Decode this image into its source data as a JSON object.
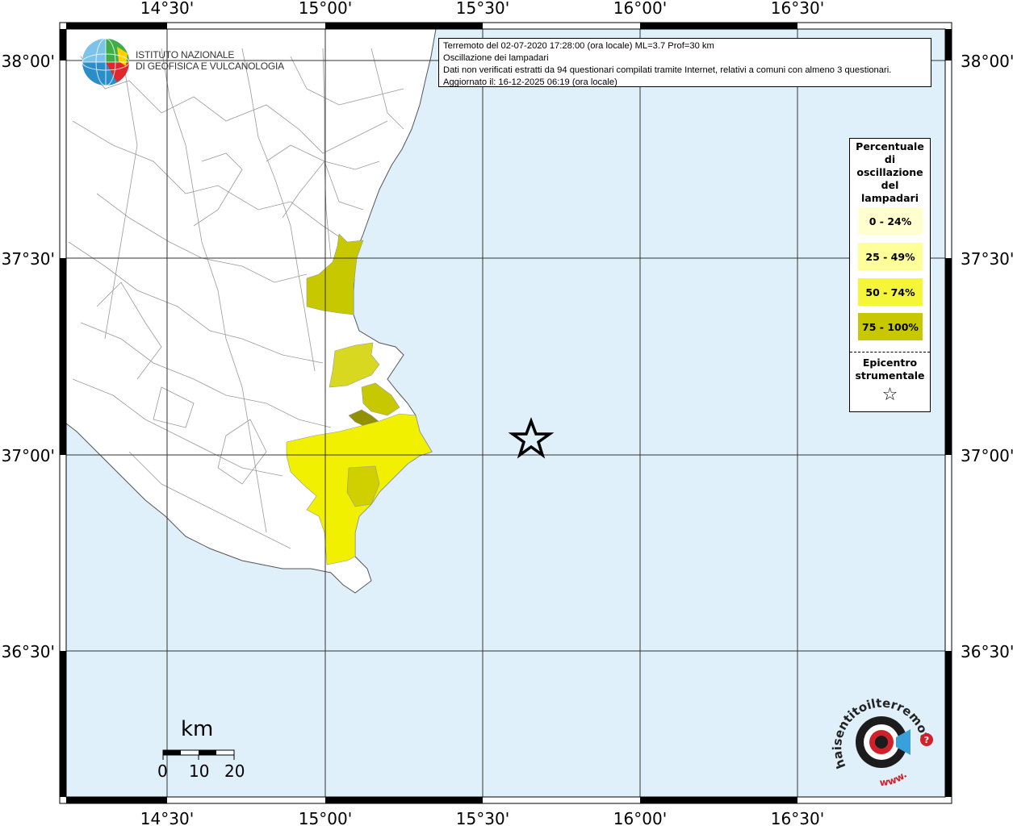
{
  "map": {
    "lon_labels": [
      "14°30'",
      "15°00'",
      "15°30'",
      "16°00'",
      "16°30'"
    ],
    "lat_labels": [
      "38°00'",
      "37°30'",
      "37°00'",
      "36°30'"
    ],
    "colors": {
      "sea": "#dff0fb",
      "land": "#ffffff",
      "border": "#999999"
    }
  },
  "institute": {
    "line1": "ISTITUTO NAZIONALE",
    "line2": "DI GEOFISICA E VULCANOLOGIA"
  },
  "info": {
    "line1": "Terremoto del 02-07-2020 17:28:00 (ora locale) ML=3.7 Prof=30 km",
    "line2": "Oscillazione dei lampadari",
    "line3": "Dati non verificati estratti da 94 questionari compilati tramite Internet, relativi a comuni con almeno 3 questionari.",
    "line4": "Aggiornato il: 16-12-2025 06:19 (ora locale)"
  },
  "legend": {
    "title_lines": [
      "Percentuale",
      "di",
      "oscillazione",
      "del",
      "lampadari"
    ],
    "classes": [
      {
        "label": "0 - 24%",
        "color": "#ffffd0"
      },
      {
        "label": "25 - 49%",
        "color": "#ffff9a"
      },
      {
        "label": "50 - 74%",
        "color": "#f5f53a"
      },
      {
        "label": "75 - 100%",
        "color": "#c8c800"
      }
    ],
    "epicenter_lines": [
      "Epicentro",
      "strumentale"
    ],
    "epicenter_symbol": "☆"
  },
  "scalebar": {
    "unit": "km",
    "labels": [
      "0",
      "10",
      "20"
    ]
  },
  "logo_hsl": {
    "text": "haisentitoilterremoto.it",
    "prefix": "www."
  }
}
